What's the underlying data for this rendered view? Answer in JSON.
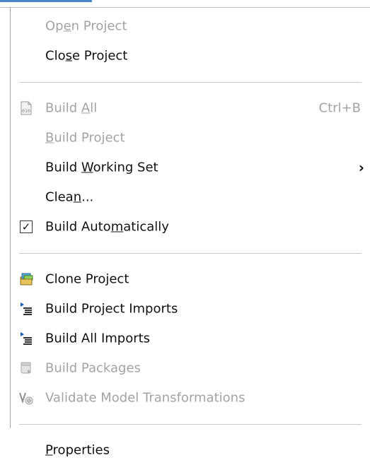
{
  "menu": {
    "items": [
      {
        "pre": "Op",
        "mn": "e",
        "post": "n Project",
        "enabled": false
      },
      {
        "pre": "Clo",
        "mn": "s",
        "post": "e Project",
        "enabled": true
      },
      {
        "pre": "Build ",
        "mn": "A",
        "post": "ll",
        "enabled": false,
        "shortcut": "Ctrl+B",
        "icon": "build-all-icon"
      },
      {
        "pre": "",
        "mn": "B",
        "post": "uild Project",
        "enabled": false
      },
      {
        "pre": "Build ",
        "mn": "W",
        "post": "orking Set",
        "enabled": true,
        "submenu_arrow": "›"
      },
      {
        "pre": "Clea",
        "mn": "n",
        "post": "...",
        "enabled": true
      },
      {
        "pre": "Build Auto",
        "mn": "m",
        "post": "atically",
        "enabled": true,
        "checked": true,
        "check_glyph": "✓"
      },
      {
        "pre": "Clone Project",
        "mn": "",
        "post": "",
        "enabled": true,
        "icon": "clone-project-icon"
      },
      {
        "pre": "Build Project Imports",
        "mn": "",
        "post": "",
        "enabled": true,
        "icon": "build-imports-icon"
      },
      {
        "pre": "Build All Imports",
        "mn": "",
        "post": "",
        "enabled": true,
        "icon": "build-imports-icon"
      },
      {
        "pre": "Build Packages",
        "mn": "",
        "post": "",
        "enabled": false,
        "icon": "build-packages-icon"
      },
      {
        "pre": "Validate Model Transformations",
        "mn": "",
        "post": "",
        "enabled": false,
        "icon": "validate-model-icon"
      },
      {
        "pre": "",
        "mn": "P",
        "post": "roperties",
        "enabled": true
      }
    ]
  },
  "icon_glyph": {
    "build_all_text": "010"
  }
}
